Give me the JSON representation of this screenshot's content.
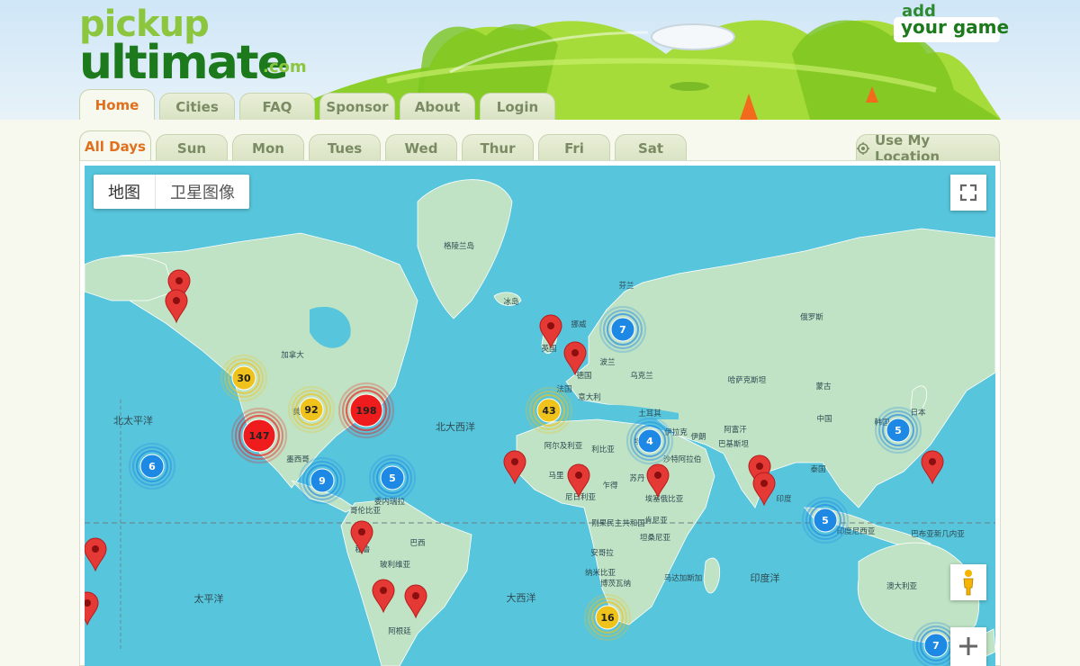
{
  "header": {
    "logo_top": "pickup",
    "logo_main": "ultimate",
    "logo_suffix": ".com",
    "add_small": "add",
    "add_big": "your game"
  },
  "nav_tabs": [
    "Home",
    "Cities",
    "FAQ",
    "Sponsor",
    "About",
    "Login"
  ],
  "day_tabs": [
    "All Days",
    "Sun",
    "Mon",
    "Tues",
    "Wed",
    "Thur",
    "Fri",
    "Sat"
  ],
  "location_button": "Use My Location",
  "map": {
    "type_labels": [
      "地图",
      "卫星图像"
    ],
    "labels": [
      "格陵兰岛",
      "冰岛",
      "芬兰",
      "挪威",
      "英国",
      "德国",
      "波兰",
      "乌克兰",
      "法国",
      "意大利",
      "加拿大",
      "美国",
      "墨西哥",
      "北太平洋",
      "北大西洋",
      "俄罗斯",
      "哈萨克斯坦",
      "蒙古",
      "中国",
      "日本",
      "韩国",
      "土耳其",
      "伊拉克",
      "伊朗",
      "阿富汗",
      "巴基斯坦",
      "沙特阿拉伯",
      "埃及",
      "利比亚",
      "阿尔及利亚",
      "马里",
      "尼日利亚",
      "乍得",
      "苏丹",
      "埃塞俄比亚",
      "泰国",
      "印度",
      "委内瑞拉",
      "哥伦比亚",
      "秘鲁",
      "巴西",
      "玻利维亚",
      "阿根廷",
      "刚果民主共和国",
      "肯尼亚",
      "坦桑尼亚",
      "安哥拉",
      "纳米比亚",
      "博茨瓦纳",
      "马达加斯加",
      "印度尼西亚",
      "巴布亚新几内亚",
      "澳大利亚",
      "太平洋",
      "大西洋",
      "印度洋"
    ],
    "clusters": [
      {
        "count": "30",
        "color": "#f0c21c"
      },
      {
        "count": "92",
        "color": "#f0c21c"
      },
      {
        "count": "198",
        "color": "#ee1c1c"
      },
      {
        "count": "147",
        "color": "#ee1c1c"
      },
      {
        "count": "43",
        "color": "#f0c21c"
      },
      {
        "count": "7",
        "color": "#1e88e5"
      },
      {
        "count": "6",
        "color": "#1e88e5"
      },
      {
        "count": "9",
        "color": "#1e88e5"
      },
      {
        "count": "5",
        "color": "#1e88e5"
      },
      {
        "count": "4",
        "color": "#1e88e5"
      },
      {
        "count": "5",
        "color": "#1e88e5"
      },
      {
        "count": "5",
        "color": "#1e88e5"
      },
      {
        "count": "16",
        "color": "#f0c21c"
      },
      {
        "count": "7",
        "color": "#1e88e5"
      }
    ],
    "pin_color": "#e53935",
    "land_color": "#bfe3c4",
    "water_color": "#57c5dc"
  }
}
